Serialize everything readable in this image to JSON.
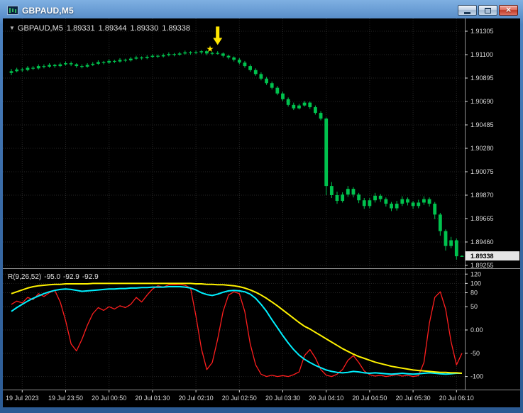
{
  "window": {
    "title": "GBPAUD,M5",
    "close_glyph": "×"
  },
  "chart_header": {
    "collapse_icon": "▼",
    "symbol": "GBPAUD,M5",
    "open": "1.89331",
    "high": "1.89344",
    "low": "1.89330",
    "close": "1.89338"
  },
  "indicator_label": {
    "name": "R(9,26,52)",
    "values": [
      "-95.0",
      "-92.9",
      "-92.9"
    ]
  },
  "price_axis": {
    "labels": [
      "1.91305",
      "1.91100",
      "1.90895",
      "1.90690",
      "1.90485",
      "1.90280",
      "1.90075",
      "1.89870",
      "1.89665",
      "1.89460",
      "1.89255"
    ],
    "current_price": "1.89338"
  },
  "time_axis": {
    "labels": [
      "19 Jul 2023",
      "19 Jul 23:50",
      "20 Jul 00:50",
      "20 Jul 01:30",
      "20 Jul 02:10",
      "20 Jul 02:50",
      "20 Jul 03:30",
      "20 Jul 04:10",
      "20 Jul 04:50",
      "20 Jul 05:30",
      "20 Jul 06:10"
    ],
    "tick_indices": [
      2,
      10,
      18,
      26,
      34,
      42,
      50,
      58,
      66,
      74,
      82
    ]
  },
  "annotations": {
    "arrow": {
      "type": "down-arrow",
      "index": 38,
      "price": 1.91185,
      "color": "#ffe600"
    },
    "star": {
      "glyph": "★",
      "index": 36.6,
      "price": 1.9115,
      "color": "#ffe600"
    }
  },
  "colors": {
    "background": "#000000",
    "grid": "#262626",
    "candle": "#00c24e",
    "axis_text": "#dcdcdc",
    "separator": "#909090",
    "price_box_bg": "#e6e6e6",
    "price_box_text": "#000000"
  },
  "chart_data": {
    "type": "candlestick",
    "symbol": "GBPAUD",
    "timeframe": "M5",
    "title": "GBPAUD,M5",
    "price_axis": {
      "top": 1.91305,
      "bottom": 1.89255
    },
    "candles": [
      [
        1.9094,
        1.90975,
        1.9092,
        1.90955
      ],
      [
        1.90955,
        1.90985,
        1.90945,
        1.9097
      ],
      [
        1.9097,
        1.90985,
        1.9095,
        1.90965
      ],
      [
        1.90965,
        1.91,
        1.90955,
        1.90985
      ],
      [
        1.90985,
        1.91,
        1.90965,
        1.9098
      ],
      [
        1.9098,
        1.91015,
        1.9097,
        1.91
      ],
      [
        1.91,
        1.91015,
        1.9098,
        1.90995
      ],
      [
        1.90995,
        1.91025,
        1.90985,
        1.9101
      ],
      [
        1.9101,
        1.9102,
        1.90985,
        1.91
      ],
      [
        1.91,
        1.9103,
        1.9099,
        1.91015
      ],
      [
        1.91015,
        1.9104,
        1.91005,
        1.91025
      ],
      [
        1.91025,
        1.9104,
        1.91,
        1.91015
      ],
      [
        1.91015,
        1.91025,
        1.90985,
        1.91
      ],
      [
        1.91,
        1.91015,
        1.9098,
        1.90995
      ],
      [
        1.90995,
        1.91025,
        1.90985,
        1.9101
      ],
      [
        1.9101,
        1.91035,
        1.91,
        1.9102
      ],
      [
        1.9102,
        1.9105,
        1.9101,
        1.91035
      ],
      [
        1.91035,
        1.91045,
        1.91015,
        1.9103
      ],
      [
        1.9103,
        1.9106,
        1.9102,
        1.91045
      ],
      [
        1.91045,
        1.91055,
        1.91025,
        1.9104
      ],
      [
        1.9104,
        1.9107,
        1.9103,
        1.91055
      ],
      [
        1.91055,
        1.91065,
        1.91035,
        1.9105
      ],
      [
        1.9105,
        1.9108,
        1.9104,
        1.91065
      ],
      [
        1.91065,
        1.9109,
        1.91055,
        1.91075
      ],
      [
        1.91075,
        1.91085,
        1.91055,
        1.9107
      ],
      [
        1.9107,
        1.91095,
        1.9106,
        1.9108
      ],
      [
        1.9108,
        1.91105,
        1.9107,
        1.9109
      ],
      [
        1.9109,
        1.911,
        1.9107,
        1.91085
      ],
      [
        1.91085,
        1.9111,
        1.91075,
        1.91095
      ],
      [
        1.91095,
        1.9112,
        1.91085,
        1.91105
      ],
      [
        1.91105,
        1.91115,
        1.91085,
        1.911
      ],
      [
        1.911,
        1.91125,
        1.9109,
        1.9111
      ],
      [
        1.9111,
        1.91135,
        1.911,
        1.9112
      ],
      [
        1.9112,
        1.9113,
        1.911,
        1.91115
      ],
      [
        1.91115,
        1.91135,
        1.91105,
        1.9112
      ],
      [
        1.9112,
        1.9114,
        1.91105,
        1.9113
      ],
      [
        1.9113,
        1.9114,
        1.91095,
        1.9111
      ],
      [
        1.9111,
        1.91125,
        1.91095,
        1.91115
      ],
      [
        1.91115,
        1.9113,
        1.911,
        1.9111
      ],
      [
        1.9111,
        1.9112,
        1.91075,
        1.9109
      ],
      [
        1.9109,
        1.911,
        1.9106,
        1.91075
      ],
      [
        1.91075,
        1.91085,
        1.9104,
        1.91055
      ],
      [
        1.91055,
        1.9107,
        1.91015,
        1.9103
      ],
      [
        1.9103,
        1.91045,
        1.90985,
        1.91
      ],
      [
        1.91,
        1.91015,
        1.9095,
        1.90965
      ],
      [
        1.90965,
        1.9098,
        1.90915,
        1.9093
      ],
      [
        1.9093,
        1.90945,
        1.90875,
        1.9089
      ],
      [
        1.9089,
        1.90905,
        1.90835,
        1.9085
      ],
      [
        1.9085,
        1.90865,
        1.90795,
        1.9081
      ],
      [
        1.9081,
        1.90825,
        1.90745,
        1.9076
      ],
      [
        1.9076,
        1.90775,
        1.90695,
        1.9071
      ],
      [
        1.9071,
        1.90725,
        1.90645,
        1.9066
      ],
      [
        1.9066,
        1.9068,
        1.90615,
        1.9063
      ],
      [
        1.9063,
        1.9067,
        1.9062,
        1.90655
      ],
      [
        1.90655,
        1.90695,
        1.90645,
        1.9068
      ],
      [
        1.9068,
        1.9069,
        1.90625,
        1.9064
      ],
      [
        1.9064,
        1.90655,
        1.90575,
        1.9059
      ],
      [
        1.9059,
        1.90605,
        1.90525,
        1.9054
      ],
      [
        1.9054,
        1.9055,
        1.8987,
        1.8995
      ],
      [
        1.8995,
        1.89985,
        1.89845,
        1.8987
      ],
      [
        1.8987,
        1.899,
        1.89795,
        1.8982
      ],
      [
        1.8982,
        1.89895,
        1.89805,
        1.89875
      ],
      [
        1.89875,
        1.8995,
        1.89855,
        1.89925
      ],
      [
        1.89925,
        1.8994,
        1.8985,
        1.89875
      ],
      [
        1.89875,
        1.8989,
        1.898,
        1.89825
      ],
      [
        1.89825,
        1.89845,
        1.8975,
        1.89775
      ],
      [
        1.89775,
        1.89845,
        1.89755,
        1.89825
      ],
      [
        1.89825,
        1.8989,
        1.89805,
        1.89865
      ],
      [
        1.89865,
        1.8988,
        1.8981,
        1.89835
      ],
      [
        1.89835,
        1.8985,
        1.8977,
        1.89795
      ],
      [
        1.89795,
        1.8981,
        1.8973,
        1.89755
      ],
      [
        1.89755,
        1.8982,
        1.89735,
        1.89795
      ],
      [
        1.89795,
        1.8986,
        1.89775,
        1.89835
      ],
      [
        1.89835,
        1.8985,
        1.8978,
        1.89805
      ],
      [
        1.89805,
        1.8982,
        1.8975,
        1.89775
      ],
      [
        1.89775,
        1.8983,
        1.89755,
        1.89805
      ],
      [
        1.89805,
        1.8986,
        1.89785,
        1.89835
      ],
      [
        1.89835,
        1.8985,
        1.8977,
        1.89795
      ],
      [
        1.89795,
        1.8981,
        1.8966,
        1.897
      ],
      [
        1.897,
        1.89715,
        1.89515,
        1.89555
      ],
      [
        1.89555,
        1.8957,
        1.89385,
        1.89425
      ],
      [
        1.89425,
        1.89505,
        1.89405,
        1.89475
      ],
      [
        1.89475,
        1.8949,
        1.89305,
        1.89335
      ],
      [
        1.89331,
        1.89344,
        1.8933,
        1.89338
      ]
    ],
    "oscillator": {
      "name": "R(9,26,52)",
      "axis_max": 128,
      "axis_min": -128,
      "levels": [
        {
          "label": "120",
          "value": 120
        },
        {
          "label": "100",
          "value": 100
        },
        {
          "label": "80",
          "value": 80
        },
        {
          "label": "50",
          "value": 50
        },
        {
          "label": "0.00",
          "value": 0
        },
        {
          "label": "-50",
          "value": -50
        },
        {
          "label": "-100",
          "value": -100
        }
      ],
      "series": [
        {
          "name": "R9",
          "color": "#ff1e1e",
          "width": 1.3,
          "values": [
            55,
            62,
            58,
            70,
            65,
            78,
            72,
            80,
            85,
            60,
            20,
            -30,
            -45,
            -20,
            10,
            35,
            48,
            42,
            50,
            45,
            52,
            48,
            55,
            70,
            60,
            75,
            88,
            95,
            92,
            97,
            97,
            98,
            96,
            90,
            30,
            -40,
            -85,
            -70,
            -20,
            40,
            75,
            82,
            78,
            40,
            -30,
            -75,
            -95,
            -100,
            -97,
            -100,
            -98,
            -100,
            -96,
            -90,
            -55,
            -42,
            -60,
            -85,
            -97,
            -100,
            -95,
            -85,
            -65,
            -55,
            -70,
            -88,
            -96,
            -99,
            -97,
            -100,
            -98,
            -96,
            -99,
            -97,
            -100,
            -98,
            -70,
            15,
            70,
            82,
            45,
            -25,
            -75,
            -50
          ]
        },
        {
          "name": "R26",
          "color": "#00f0ff",
          "width": 2,
          "values": [
            40,
            48,
            55,
            62,
            68,
            73,
            78,
            82,
            85,
            87,
            88,
            87,
            85,
            83,
            84,
            85,
            86,
            87,
            88,
            88,
            89,
            89,
            90,
            90,
            91,
            91,
            92,
            92,
            92,
            93,
            93,
            93,
            92,
            90,
            86,
            80,
            76,
            74,
            77,
            81,
            84,
            85,
            84,
            82,
            77,
            68,
            55,
            40,
            22,
            5,
            -12,
            -28,
            -42,
            -54,
            -63,
            -70,
            -76,
            -81,
            -86,
            -89,
            -91,
            -92,
            -91,
            -89,
            -90,
            -92,
            -93,
            -92,
            -93,
            -94,
            -95,
            -94,
            -93,
            -94,
            -95,
            -94,
            -93,
            -92,
            -93,
            -94,
            -95,
            -94,
            -93,
            -92.9
          ]
        },
        {
          "name": "R52",
          "color": "#fff200",
          "width": 2,
          "values": [
            78,
            82,
            86,
            90,
            93,
            95,
            96,
            97,
            98,
            98,
            99,
            99,
            99,
            99,
            99,
            100,
            100,
            100,
            100,
            100,
            100,
            100,
            100,
            100,
            100,
            100,
            100,
            100,
            100,
            100,
            100,
            100,
            100,
            100,
            99,
            99,
            98,
            98,
            97,
            97,
            96,
            95,
            93,
            90,
            86,
            81,
            75,
            68,
            60,
            52,
            43,
            34,
            25,
            16,
            8,
            2,
            -5,
            -12,
            -19,
            -26,
            -33,
            -40,
            -46,
            -52,
            -57,
            -61,
            -65,
            -69,
            -72,
            -75,
            -78,
            -80,
            -82,
            -84,
            -86,
            -87,
            -88,
            -89,
            -90,
            -91,
            -91,
            -92,
            -92,
            -92.9
          ]
        }
      ]
    }
  }
}
